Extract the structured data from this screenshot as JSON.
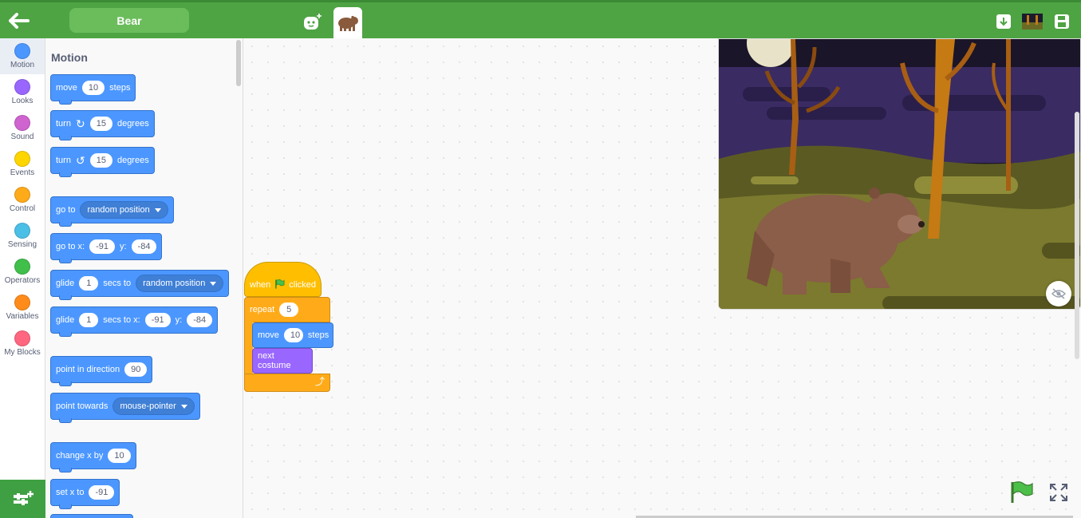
{
  "header": {
    "sprite_name": "Bear"
  },
  "categories": [
    {
      "label": "Motion",
      "color": "#4c97ff"
    },
    {
      "label": "Looks",
      "color": "#9966ff"
    },
    {
      "label": "Sound",
      "color": "#cf63cf"
    },
    {
      "label": "Events",
      "color": "#ffd500"
    },
    {
      "label": "Control",
      "color": "#ffab19"
    },
    {
      "label": "Sensing",
      "color": "#4cbfe6"
    },
    {
      "label": "Operators",
      "color": "#40bf4a"
    },
    {
      "label": "Variables",
      "color": "#ff8c1a"
    },
    {
      "label": "My Blocks",
      "color": "#ff6680"
    }
  ],
  "palette": {
    "title": "Motion",
    "blocks": {
      "move": {
        "a": "move",
        "v": "10",
        "b": "steps"
      },
      "turn_right": {
        "a": "turn",
        "v": "15",
        "b": "degrees"
      },
      "turn_left": {
        "a": "turn",
        "v": "15",
        "b": "degrees"
      },
      "goto": {
        "a": "go to",
        "menu": "random position"
      },
      "goto_xy": {
        "a": "go to x:",
        "x": "-91",
        "ylabel": "y:",
        "y": "-84"
      },
      "glide_to": {
        "a": "glide",
        "v": "1",
        "b": "secs to",
        "menu": "random position"
      },
      "glide_xy": {
        "a": "glide",
        "v": "1",
        "b": "secs to x:",
        "x": "-91",
        "ylabel": "y:",
        "y": "-84"
      },
      "point_dir": {
        "a": "point in direction",
        "v": "90"
      },
      "point_towards": {
        "a": "point towards",
        "menu": "mouse-pointer"
      },
      "change_x": {
        "a": "change x by",
        "v": "10"
      },
      "set_x": {
        "a": "set x to",
        "v": "-91"
      }
    }
  },
  "script": {
    "hat": {
      "when": "when",
      "clicked": "clicked"
    },
    "repeat": {
      "label": "repeat",
      "count": "5"
    },
    "move": {
      "a": "move",
      "v": "10",
      "b": "steps"
    },
    "costume": {
      "label": "next costume"
    }
  },
  "colors": {
    "motion": "#4c97ff",
    "looks": "#9966ff",
    "events": "#ffbf00",
    "control": "#ffab19",
    "topbar": "#4ea443"
  }
}
